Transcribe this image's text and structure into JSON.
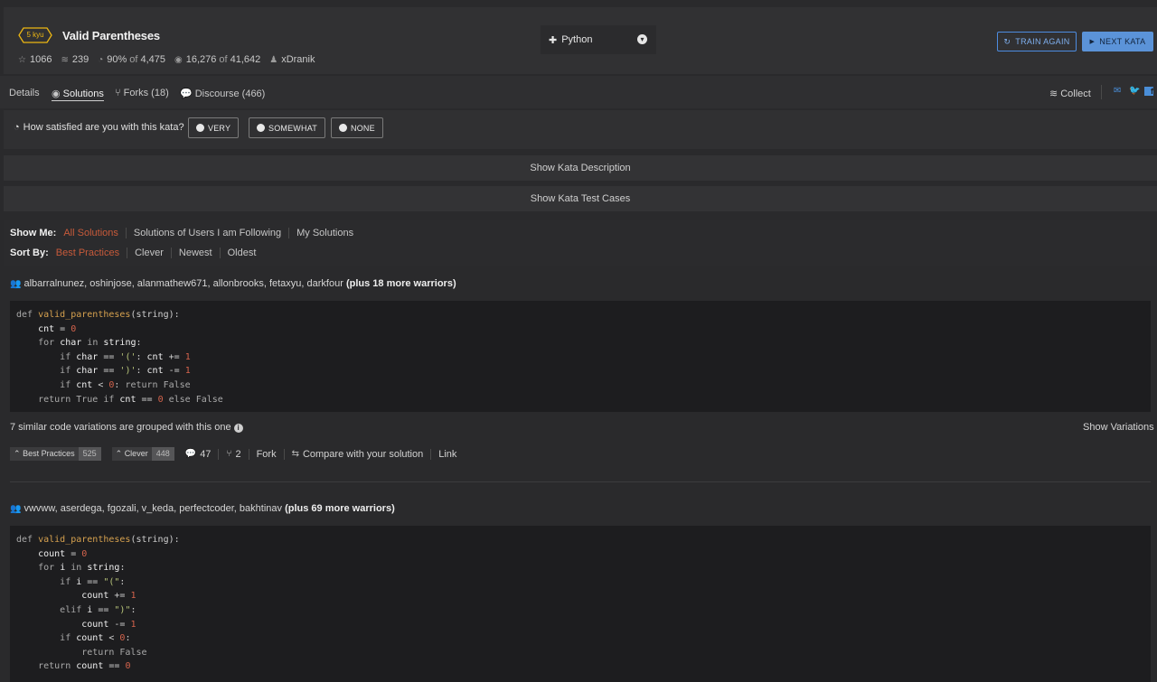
{
  "kata": {
    "rank": "5 kyu",
    "title": "Valid Parentheses",
    "stars": "1066",
    "collections": "239",
    "satisfaction": "90%",
    "of_label": "of",
    "satisfaction_votes": "4,475",
    "completed": "16,276",
    "attempts": "41,642",
    "author": "xDranik"
  },
  "language": {
    "selected": "Python"
  },
  "header_buttons": {
    "train_again": "TRAIN AGAIN",
    "next_kata": "NEXT KATA"
  },
  "tabs": [
    {
      "label": "Details"
    },
    {
      "label": "Solutions"
    },
    {
      "label": "Forks (18)"
    },
    {
      "label": "Discourse (466)"
    }
  ],
  "collect_label": "Collect",
  "satisfaction_prompt": {
    "question": "How satisfied are you with this kata?",
    "options": [
      "VERY",
      "SOMEWHAT",
      "NONE"
    ]
  },
  "show_description": "Show Kata Description",
  "show_test_cases": "Show Kata Test Cases",
  "filters": {
    "show_me_label": "Show Me:",
    "show_me": [
      "All Solutions",
      "Solutions of Users I am Following",
      "My Solutions"
    ],
    "sort_by_label": "Sort By:",
    "sort_by": [
      "Best Practices",
      "Clever",
      "Newest",
      "Oldest"
    ]
  },
  "solutions": [
    {
      "authors": "albarralnunez, oshinjose, alanmathew671, allonbrooks, fetaxyu, darkfour",
      "more": "(plus 18 more warriors)",
      "similar_text": "7 similar code variations are grouped with this one",
      "show_variations": "Show Variations",
      "best_practices_label": "Best Practices",
      "best_practices_count": "525",
      "clever_label": "Clever",
      "clever_count": "448",
      "comments": "47",
      "forks": "2",
      "fork_label": "Fork",
      "compare_label": "Compare with your solution",
      "link_label": "Link"
    },
    {
      "authors": "vwvww, aserdega, fgozali, v_keda, perfectcoder, bakhtinav",
      "more": "(plus 69 more warriors)"
    }
  ],
  "colors": {
    "background": "#2a2a2c",
    "accent_selected": "#c75a3a",
    "rank_yellow": "#ecb613",
    "next_button_blue": "#5b93d8",
    "social_blue": "#4a8ed8"
  }
}
